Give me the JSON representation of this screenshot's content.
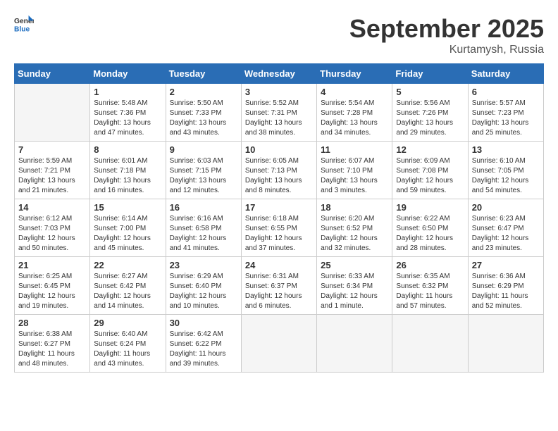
{
  "header": {
    "logo_general": "General",
    "logo_blue": "Blue",
    "month": "September 2025",
    "location": "Kurtamysh, Russia"
  },
  "days_of_week": [
    "Sunday",
    "Monday",
    "Tuesday",
    "Wednesday",
    "Thursday",
    "Friday",
    "Saturday"
  ],
  "weeks": [
    [
      {
        "day": "",
        "empty": true
      },
      {
        "day": "1",
        "sunrise": "5:48 AM",
        "sunset": "7:36 PM",
        "daylight": "13 hours and 47 minutes."
      },
      {
        "day": "2",
        "sunrise": "5:50 AM",
        "sunset": "7:33 PM",
        "daylight": "13 hours and 43 minutes."
      },
      {
        "day": "3",
        "sunrise": "5:52 AM",
        "sunset": "7:31 PM",
        "daylight": "13 hours and 38 minutes."
      },
      {
        "day": "4",
        "sunrise": "5:54 AM",
        "sunset": "7:28 PM",
        "daylight": "13 hours and 34 minutes."
      },
      {
        "day": "5",
        "sunrise": "5:56 AM",
        "sunset": "7:26 PM",
        "daylight": "13 hours and 29 minutes."
      },
      {
        "day": "6",
        "sunrise": "5:57 AM",
        "sunset": "7:23 PM",
        "daylight": "13 hours and 25 minutes."
      }
    ],
    [
      {
        "day": "7",
        "sunrise": "5:59 AM",
        "sunset": "7:21 PM",
        "daylight": "13 hours and 21 minutes."
      },
      {
        "day": "8",
        "sunrise": "6:01 AM",
        "sunset": "7:18 PM",
        "daylight": "13 hours and 16 minutes."
      },
      {
        "day": "9",
        "sunrise": "6:03 AM",
        "sunset": "7:15 PM",
        "daylight": "13 hours and 12 minutes."
      },
      {
        "day": "10",
        "sunrise": "6:05 AM",
        "sunset": "7:13 PM",
        "daylight": "13 hours and 8 minutes."
      },
      {
        "day": "11",
        "sunrise": "6:07 AM",
        "sunset": "7:10 PM",
        "daylight": "13 hours and 3 minutes."
      },
      {
        "day": "12",
        "sunrise": "6:09 AM",
        "sunset": "7:08 PM",
        "daylight": "12 hours and 59 minutes."
      },
      {
        "day": "13",
        "sunrise": "6:10 AM",
        "sunset": "7:05 PM",
        "daylight": "12 hours and 54 minutes."
      }
    ],
    [
      {
        "day": "14",
        "sunrise": "6:12 AM",
        "sunset": "7:03 PM",
        "daylight": "12 hours and 50 minutes."
      },
      {
        "day": "15",
        "sunrise": "6:14 AM",
        "sunset": "7:00 PM",
        "daylight": "12 hours and 45 minutes."
      },
      {
        "day": "16",
        "sunrise": "6:16 AM",
        "sunset": "6:58 PM",
        "daylight": "12 hours and 41 minutes."
      },
      {
        "day": "17",
        "sunrise": "6:18 AM",
        "sunset": "6:55 PM",
        "daylight": "12 hours and 37 minutes."
      },
      {
        "day": "18",
        "sunrise": "6:20 AM",
        "sunset": "6:52 PM",
        "daylight": "12 hours and 32 minutes."
      },
      {
        "day": "19",
        "sunrise": "6:22 AM",
        "sunset": "6:50 PM",
        "daylight": "12 hours and 28 minutes."
      },
      {
        "day": "20",
        "sunrise": "6:23 AM",
        "sunset": "6:47 PM",
        "daylight": "12 hours and 23 minutes."
      }
    ],
    [
      {
        "day": "21",
        "sunrise": "6:25 AM",
        "sunset": "6:45 PM",
        "daylight": "12 hours and 19 minutes."
      },
      {
        "day": "22",
        "sunrise": "6:27 AM",
        "sunset": "6:42 PM",
        "daylight": "12 hours and 14 minutes."
      },
      {
        "day": "23",
        "sunrise": "6:29 AM",
        "sunset": "6:40 PM",
        "daylight": "12 hours and 10 minutes."
      },
      {
        "day": "24",
        "sunrise": "6:31 AM",
        "sunset": "6:37 PM",
        "daylight": "12 hours and 6 minutes."
      },
      {
        "day": "25",
        "sunrise": "6:33 AM",
        "sunset": "6:34 PM",
        "daylight": "12 hours and 1 minute."
      },
      {
        "day": "26",
        "sunrise": "6:35 AM",
        "sunset": "6:32 PM",
        "daylight": "11 hours and 57 minutes."
      },
      {
        "day": "27",
        "sunrise": "6:36 AM",
        "sunset": "6:29 PM",
        "daylight": "11 hours and 52 minutes."
      }
    ],
    [
      {
        "day": "28",
        "sunrise": "6:38 AM",
        "sunset": "6:27 PM",
        "daylight": "11 hours and 48 minutes."
      },
      {
        "day": "29",
        "sunrise": "6:40 AM",
        "sunset": "6:24 PM",
        "daylight": "11 hours and 43 minutes."
      },
      {
        "day": "30",
        "sunrise": "6:42 AM",
        "sunset": "6:22 PM",
        "daylight": "11 hours and 39 minutes."
      },
      {
        "day": "",
        "empty": true
      },
      {
        "day": "",
        "empty": true
      },
      {
        "day": "",
        "empty": true
      },
      {
        "day": "",
        "empty": true
      }
    ]
  ]
}
